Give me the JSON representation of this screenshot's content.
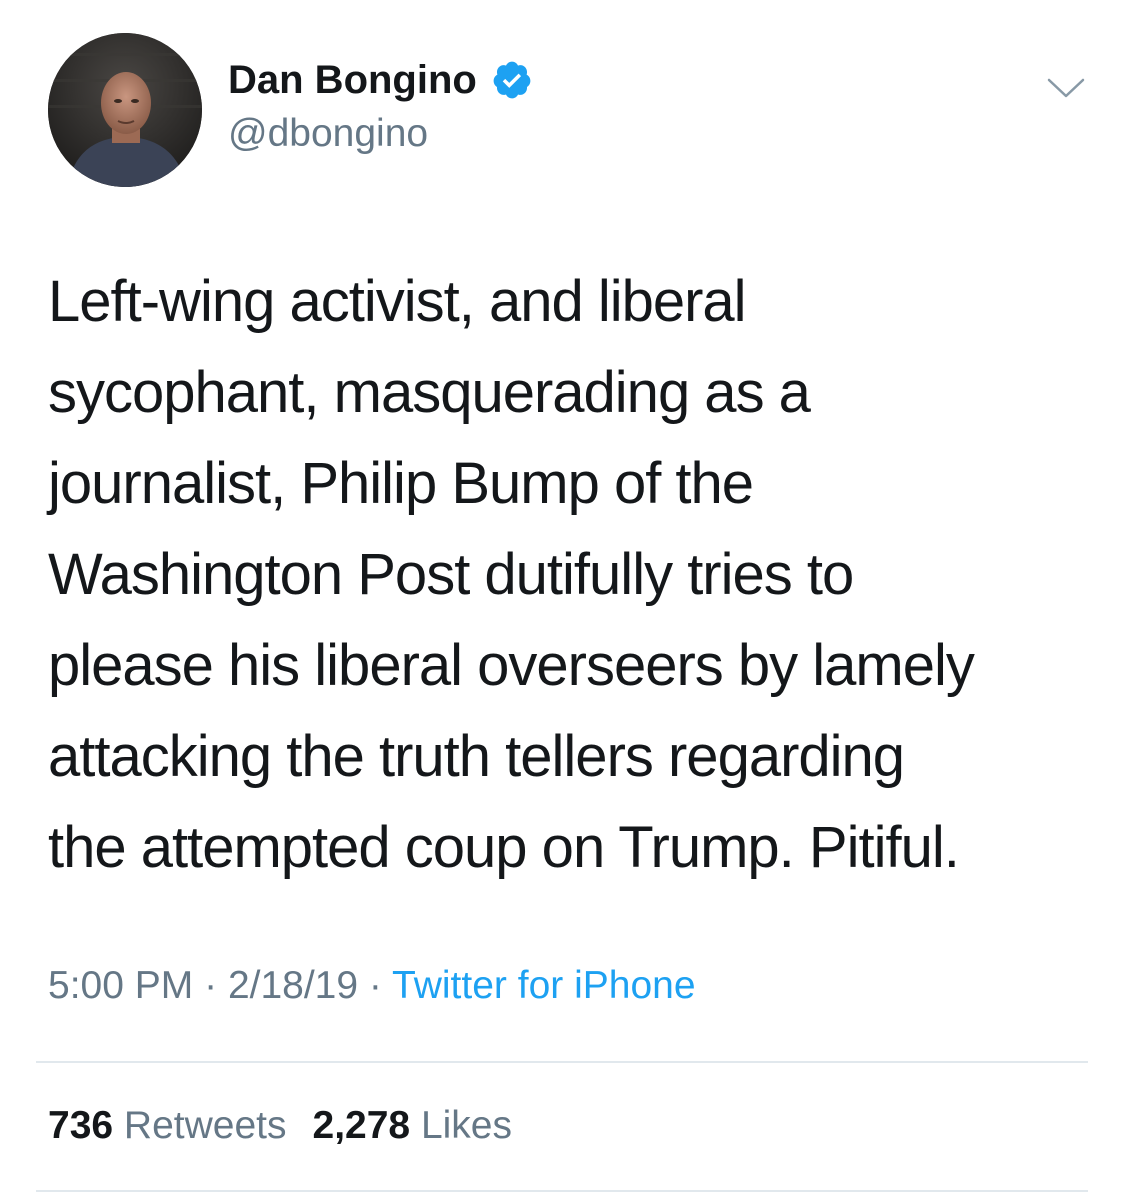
{
  "author": {
    "display_name": "Dan Bongino",
    "handle": "@dbongino",
    "verified": true
  },
  "tweet": {
    "text_lines": [
      "Left-wing activist, and liberal",
      "sycophant, masquerading as a",
      "journalist, Philip Bump of the",
      "Washington Post dutifully tries to",
      "please his liberal overseers by lamely",
      "attacking the truth tellers regarding",
      "the attempted coup on Trump. Pitiful."
    ],
    "time": "5:00 PM",
    "separator": "·",
    "date": "2/18/19",
    "source": "Twitter for iPhone"
  },
  "stats": {
    "retweets_count": "736",
    "retweets_label": "Retweets",
    "likes_count": "2,278",
    "likes_label": "Likes"
  },
  "icons": {
    "verified": "verified-badge-icon",
    "caret": "chevron-down-icon"
  },
  "colors": {
    "text_primary": "#14171a",
    "text_secondary": "#657786",
    "link_blue": "#1da1f2",
    "divider": "#e1e8ed"
  }
}
